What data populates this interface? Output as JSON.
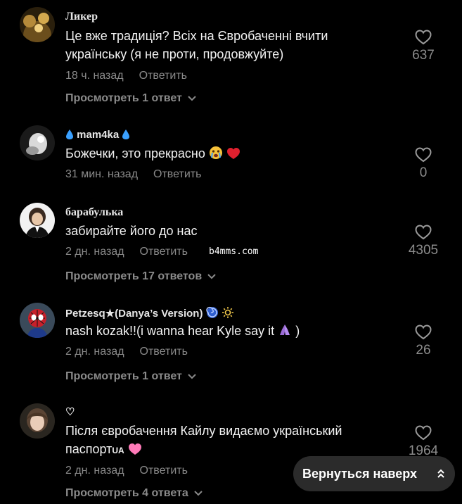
{
  "comments": [
    {
      "username": "Ликер",
      "text_lines": [
        "Це вже традиція? Всіх на Євробаченні вчити",
        "українську (я не проти, продовжуйте)"
      ],
      "time": "18 ч. назад",
      "reply_label": "Ответить",
      "likes": "637",
      "replies": "Просмотреть 1 ответ"
    },
    {
      "username": "mam4ka",
      "text": "Божечки, это прекрасно",
      "time": "31 мин. назад",
      "reply_label": "Ответить",
      "likes": "0"
    },
    {
      "username": "барабулька",
      "text": "забирайте його до нас",
      "time": "2 дн. назад",
      "reply_label": "Ответить",
      "likes": "4305",
      "replies": "Просмотреть 17 ответов"
    },
    {
      "username": "Petzesq★(Danya’s Version)",
      "text": "nash kozak!!(i wanna hear Kyle say it",
      "text_end": ")",
      "time": "2 дн. назад",
      "reply_label": "Ответить",
      "likes": "26",
      "replies": "Просмотреть 1 ответ"
    },
    {
      "username": "♡",
      "text_lines": [
        "Після євробачення Кайлу видаємо український",
        "паспорт"
      ],
      "text_suffix": "UA",
      "time": "2 дн. назад",
      "reply_label": "Ответить",
      "likes": "1964",
      "replies": "Просмотреть 4 ответа"
    }
  ],
  "watermark": "b4mms.com",
  "back_to_top_label": "Вернуться наверх",
  "icons": {
    "like": "heart-outline-icon",
    "expand": "chevron-down-icon",
    "scroll_up": "double-chevron-up-icon"
  },
  "colors": {
    "background": "#000000",
    "text": "#f2f2f2",
    "muted": "#8a8a8a",
    "button_bg": "#2b2b2b",
    "droplet": "#3aa0ff",
    "heart_red": "#e0202e",
    "heart_pink": "#ff7ab8"
  }
}
